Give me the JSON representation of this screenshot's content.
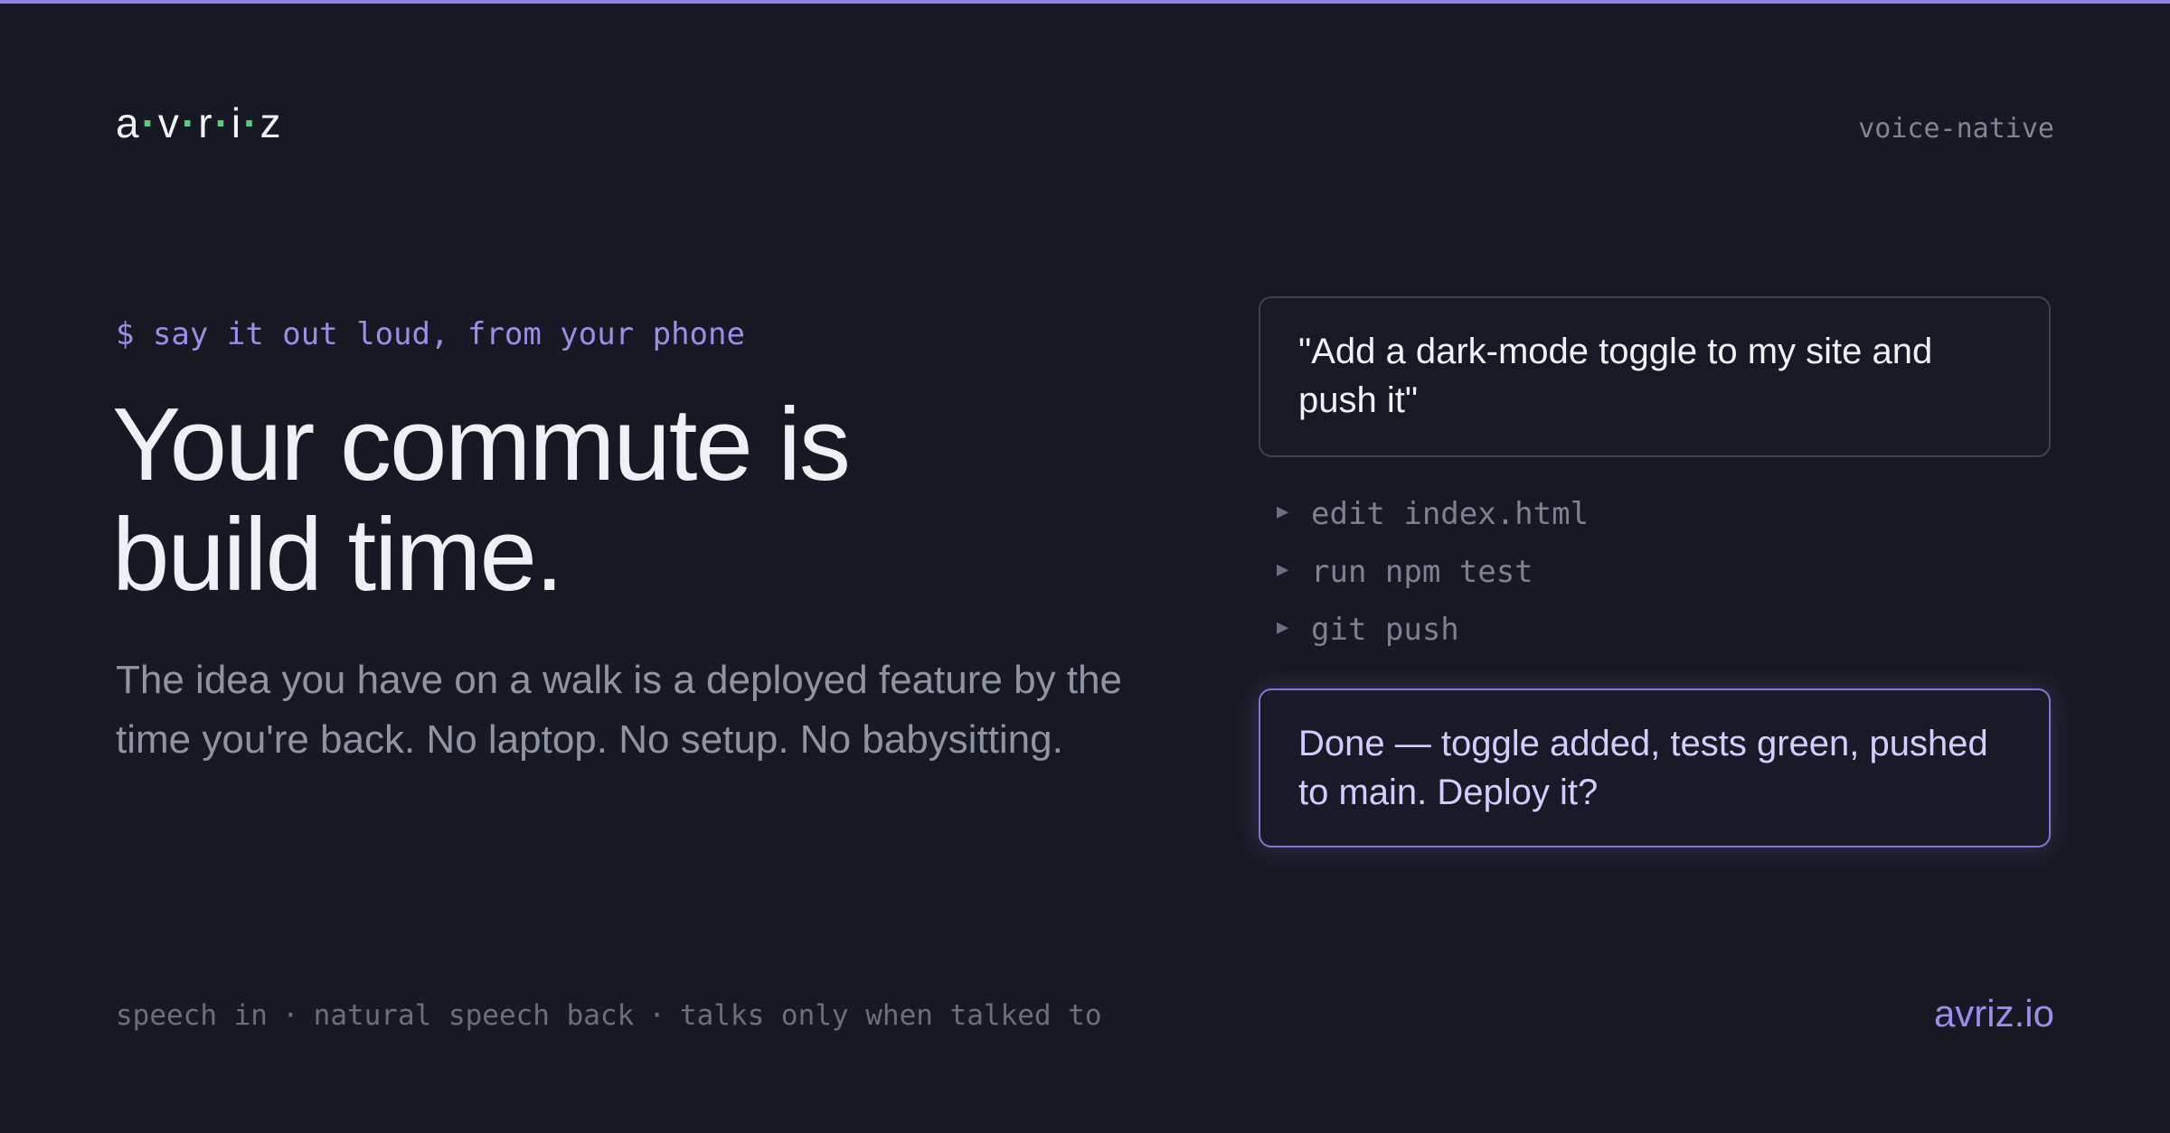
{
  "brand": {
    "letters": [
      "a",
      "v",
      "r",
      "i",
      "z"
    ],
    "separator": "·",
    "dot_color": "#4fd37a",
    "accent_color": "#9a8ee6"
  },
  "header": {
    "tag": "voice-native"
  },
  "hero": {
    "prompt": "$ say it out loud, from your phone",
    "headline_line1": "Your commute is",
    "headline_line2": "build time.",
    "subtext": "The idea you have on a walk is a deployed feature by the time you're back. No laptop. No setup. No babysitting."
  },
  "demo": {
    "user_message": "\"Add a dark-mode toggle to my site and push it\"",
    "steps": [
      {
        "icon": "play-triangle-icon",
        "label": "edit index.html"
      },
      {
        "icon": "play-triangle-icon",
        "label": "run npm test"
      },
      {
        "icon": "play-triangle-icon",
        "label": "git push"
      }
    ],
    "reply": "Done — toggle added, tests green, pushed to main. Deploy it?"
  },
  "footer": {
    "features": [
      "speech in",
      "natural speech back",
      "talks only when talked to"
    ],
    "separator": "·",
    "domain": "avriz.io"
  }
}
